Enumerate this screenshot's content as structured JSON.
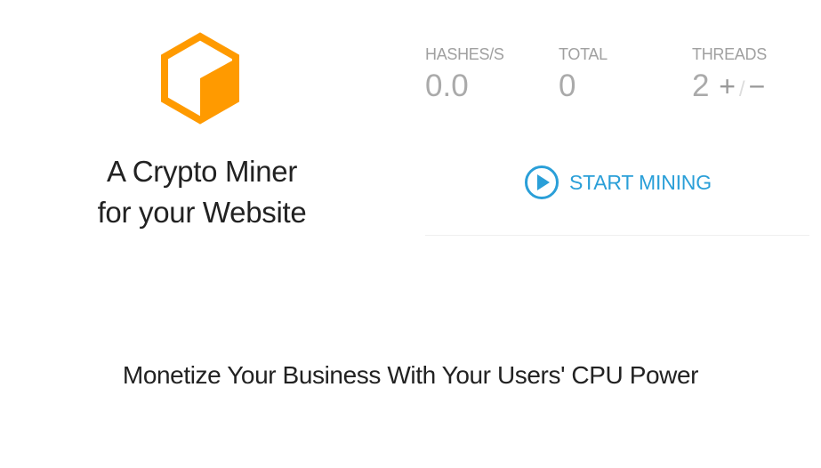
{
  "brand": {
    "logo_icon": "cube-icon",
    "accent_color": "#ff9a00",
    "tagline_line1": "A Crypto Miner",
    "tagline_line2": "for your Website"
  },
  "stats": {
    "hashes": {
      "label": "HASHES/S",
      "value": "0.0"
    },
    "total": {
      "label": "TOTAL",
      "value": "0"
    },
    "threads": {
      "label": "THREADS",
      "value": "2",
      "increase": "+",
      "separator": "/",
      "decrease": "−"
    }
  },
  "miner": {
    "start_icon": "play-circle-icon",
    "start_label": "START MINING",
    "link_color": "#2a9fd8"
  },
  "footer": {
    "subtitle": "Monetize Your Business With Your Users' CPU Power"
  }
}
